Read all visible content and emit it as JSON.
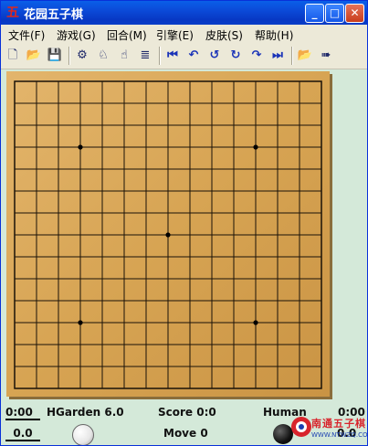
{
  "window": {
    "title": "花园五子棋",
    "app_icon": "gomoku-app-icon",
    "minimize": "_",
    "maximize": "□",
    "close": "✕"
  },
  "menu": [
    {
      "label": "文件(F)"
    },
    {
      "label": "游戏(G)"
    },
    {
      "label": "回合(M)"
    },
    {
      "label": "引擎(E)"
    },
    {
      "label": "皮肤(S)"
    },
    {
      "label": "帮助(H)"
    }
  ],
  "toolbar": {
    "icons": [
      "new-icon",
      "open-icon",
      "save-icon",
      "settings-icon",
      "engine-icon",
      "hint-icon",
      "move-list-icon",
      "first-move-icon",
      "undo-all-icon",
      "undo-icon",
      "redo-icon",
      "redo-all-icon",
      "last-move-icon",
      "load-icon",
      "export-icon"
    ]
  },
  "board": {
    "size": 15,
    "star_points": [
      [
        3,
        3
      ],
      [
        11,
        3
      ],
      [
        7,
        7
      ],
      [
        3,
        11
      ],
      [
        11,
        11
      ]
    ]
  },
  "status": {
    "left_time": "0:00",
    "engine_name": "HGarden 6.0",
    "score": "Score 0:0",
    "right_player": "Human",
    "right_time": "0:00",
    "left_value": "0.0",
    "move": "Move 0",
    "right_value": "0.0"
  },
  "watermark": {
    "text": "南通五子棋",
    "url": "WWW.NTWZQ.COM"
  },
  "colors": {
    "title_blue": "#0b4ad8",
    "board_wood": "#d7a453",
    "background": "#d4e9d9",
    "watermark_red": "#d8242c"
  }
}
